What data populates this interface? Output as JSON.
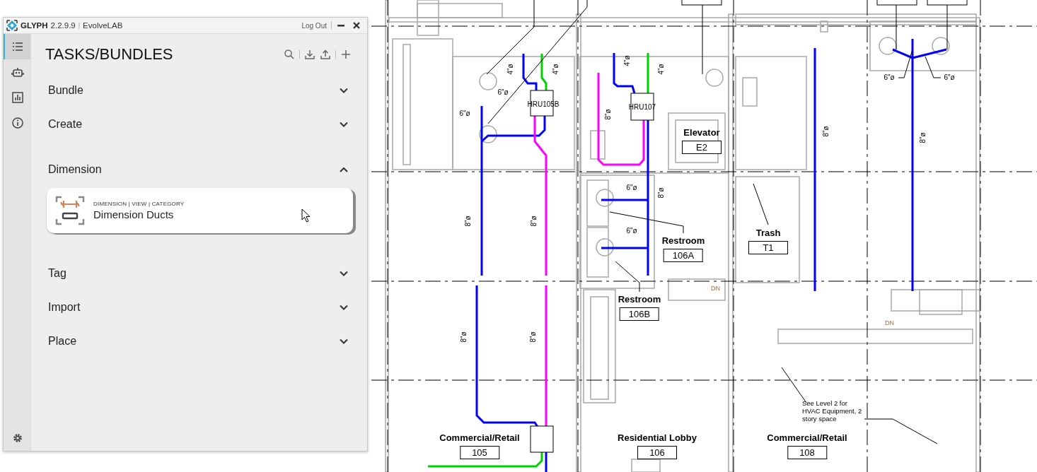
{
  "app": {
    "logo": "GLYPH",
    "version": "2.2.9.9",
    "separator": "|",
    "company": "EvolveLAB",
    "logout": "Log Out"
  },
  "sidebar": {
    "items": [
      {
        "kind": "list",
        "selected": true
      },
      {
        "kind": "robot",
        "selected": false
      },
      {
        "kind": "chart",
        "selected": false
      },
      {
        "kind": "info",
        "selected": false
      }
    ]
  },
  "panel": {
    "title": "TASKS/BUNDLES",
    "sections": [
      {
        "title": "Bundle",
        "expanded": false
      },
      {
        "title": "Create",
        "expanded": false
      },
      {
        "title": "Dimension",
        "expanded": true,
        "tasks": [
          {
            "category": "DIMENSION | VIEW | CATEGORY",
            "name": "Dimension Ducts"
          }
        ]
      },
      {
        "title": "Tag",
        "expanded": false
      },
      {
        "title": "Import",
        "expanded": false
      },
      {
        "title": "Place",
        "expanded": false
      }
    ]
  },
  "drawing": {
    "equipment": [
      "HRU105B",
      "HRU107"
    ],
    "duct_sizes": [
      "4\"ø",
      "4\"ø",
      "4\"ø",
      "4\"ø",
      "6\"ø",
      "6\"ø",
      "8\"ø",
      "6\"ø",
      "6\"ø",
      "8\"ø",
      "8\"ø",
      "6\"ø",
      "8\"ø",
      "8\"ø",
      "8\"ø",
      "6\"ø",
      "8\"ø",
      "8\"ø"
    ],
    "rooms": [
      {
        "name": "Elevator",
        "number": "E2"
      },
      {
        "name": "Restroom",
        "number": "106A"
      },
      {
        "name": "Trash",
        "number": "T1"
      },
      {
        "name": "Restroom",
        "number": "106B"
      },
      {
        "name": "Commercial/Retail",
        "number": "105"
      },
      {
        "name": "Residential Lobby",
        "number": "106"
      },
      {
        "name": "Commercial/Retail",
        "number": "108"
      }
    ],
    "stair_labels": [
      "DN",
      "DN"
    ],
    "notes": [
      "See Level 2 for HVAC Equipment, 2 story space"
    ]
  }
}
